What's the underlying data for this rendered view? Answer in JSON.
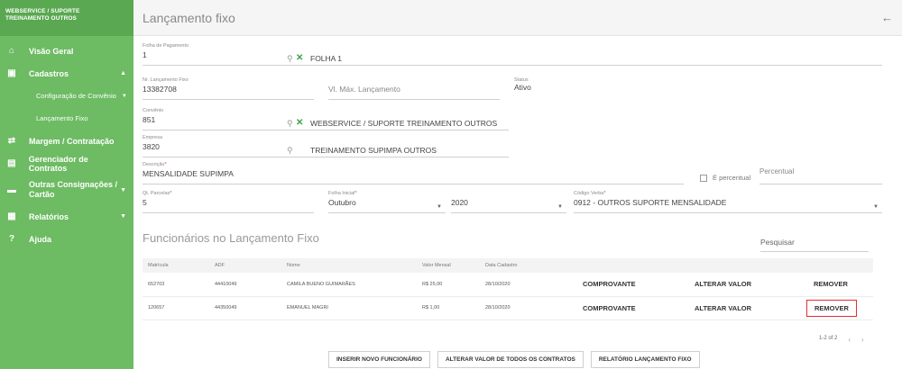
{
  "brand": {
    "line1": "WEBSERVICE / SUPORTE",
    "line2": "TREINAMENTO OUTROS"
  },
  "sidebar": {
    "items": [
      {
        "label": "Visão Geral",
        "icon": "home-icon"
      },
      {
        "label": "Cadastros",
        "icon": "document-icon",
        "caret": "▲"
      },
      {
        "label": "Configuração de Convênio",
        "sub": true,
        "caret": "▼"
      },
      {
        "label": "Lançamento Fixo",
        "sub": true
      },
      {
        "label": "Margem / Contratação",
        "icon": "handshake-icon"
      },
      {
        "label": "Gerenciador de Contratos",
        "icon": "contract-icon"
      },
      {
        "label_line1": "Outras Consignações /",
        "label_line2": "Cartão",
        "icon": "card-icon",
        "caret": "▼"
      },
      {
        "label": "Relatórios",
        "icon": "report-icon",
        "caret": "▼"
      },
      {
        "label": "Ajuda",
        "icon": "help-icon"
      }
    ]
  },
  "header": {
    "title": "Lançamento fixo"
  },
  "form": {
    "folha": {
      "label": "Folha de Pagamento",
      "value": "1",
      "text": "FOLHA 1"
    },
    "nr_lancamento": {
      "label": "Nr. Lançamento Fixo",
      "value": "13382708"
    },
    "vl_max": {
      "placeholder": "Vl. Máx. Lançamento"
    },
    "status": {
      "label": "Status",
      "value": "Ativo"
    },
    "convenio": {
      "label": "Convênio",
      "value": "851",
      "text": "WEBSERVICE / SUPORTE TREINAMENTO OUTROS"
    },
    "empresa": {
      "label": "Empresa",
      "value": "3820",
      "text": "TREINAMENTO SUPIMPA OUTROS"
    },
    "descricao": {
      "label": "Descrição",
      "value": "MENSALIDADE SUPIMPA"
    },
    "percentual": {
      "checkbox_label": "É percentual",
      "placeholder": "Percentual"
    },
    "qt_parcelas": {
      "label": "Qt. Parcelas",
      "value": "5"
    },
    "folha_inicial": {
      "label": "Folha Inicial",
      "month": "Outubro",
      "year": "2020"
    },
    "codigo_verba": {
      "label": "Código Verba",
      "value": "0912 - OUTROS SUPORTE MENSALIDADE"
    }
  },
  "section": {
    "title": "Funcionários no Lançamento Fixo",
    "search_placeholder": "Pesquisar"
  },
  "table": {
    "headers": [
      "Matrícula",
      "ADF",
      "Nome",
      "Valor Mensal",
      "Data Cadastro",
      "",
      "",
      ""
    ],
    "rows": [
      {
        "matricula": "652703",
        "adf": "44410049",
        "nome": "CAMILA BUENO GUIMARÃES",
        "valor": "R$ 25,00",
        "data": "28/10/2020",
        "a1": "COMPROVANTE",
        "a2": "ALTERAR VALOR",
        "a3": "REMOVER"
      },
      {
        "matricula": "120657",
        "adf": "44350049",
        "nome": "EMANUEL MAGRI",
        "valor": "R$ 1,00",
        "data": "28/10/2020",
        "a1": "COMPROVANTE",
        "a2": "ALTERAR VALOR",
        "a3": "REMOVER"
      }
    ]
  },
  "pagination": {
    "text": "1-2 of 2",
    "prev": "‹",
    "next": "›"
  },
  "buttons": {
    "insert": "INSERIR NOVO FUNCIONÁRIO",
    "alter_all": "ALTERAR VALOR DE TODOS OS CONTRATOS",
    "report": "RELATÓRIO LANÇAMENTO FIXO"
  },
  "colors": {
    "sidebar": "#6dbb63",
    "accent": "#39a548",
    "highlight": "#e03030"
  }
}
